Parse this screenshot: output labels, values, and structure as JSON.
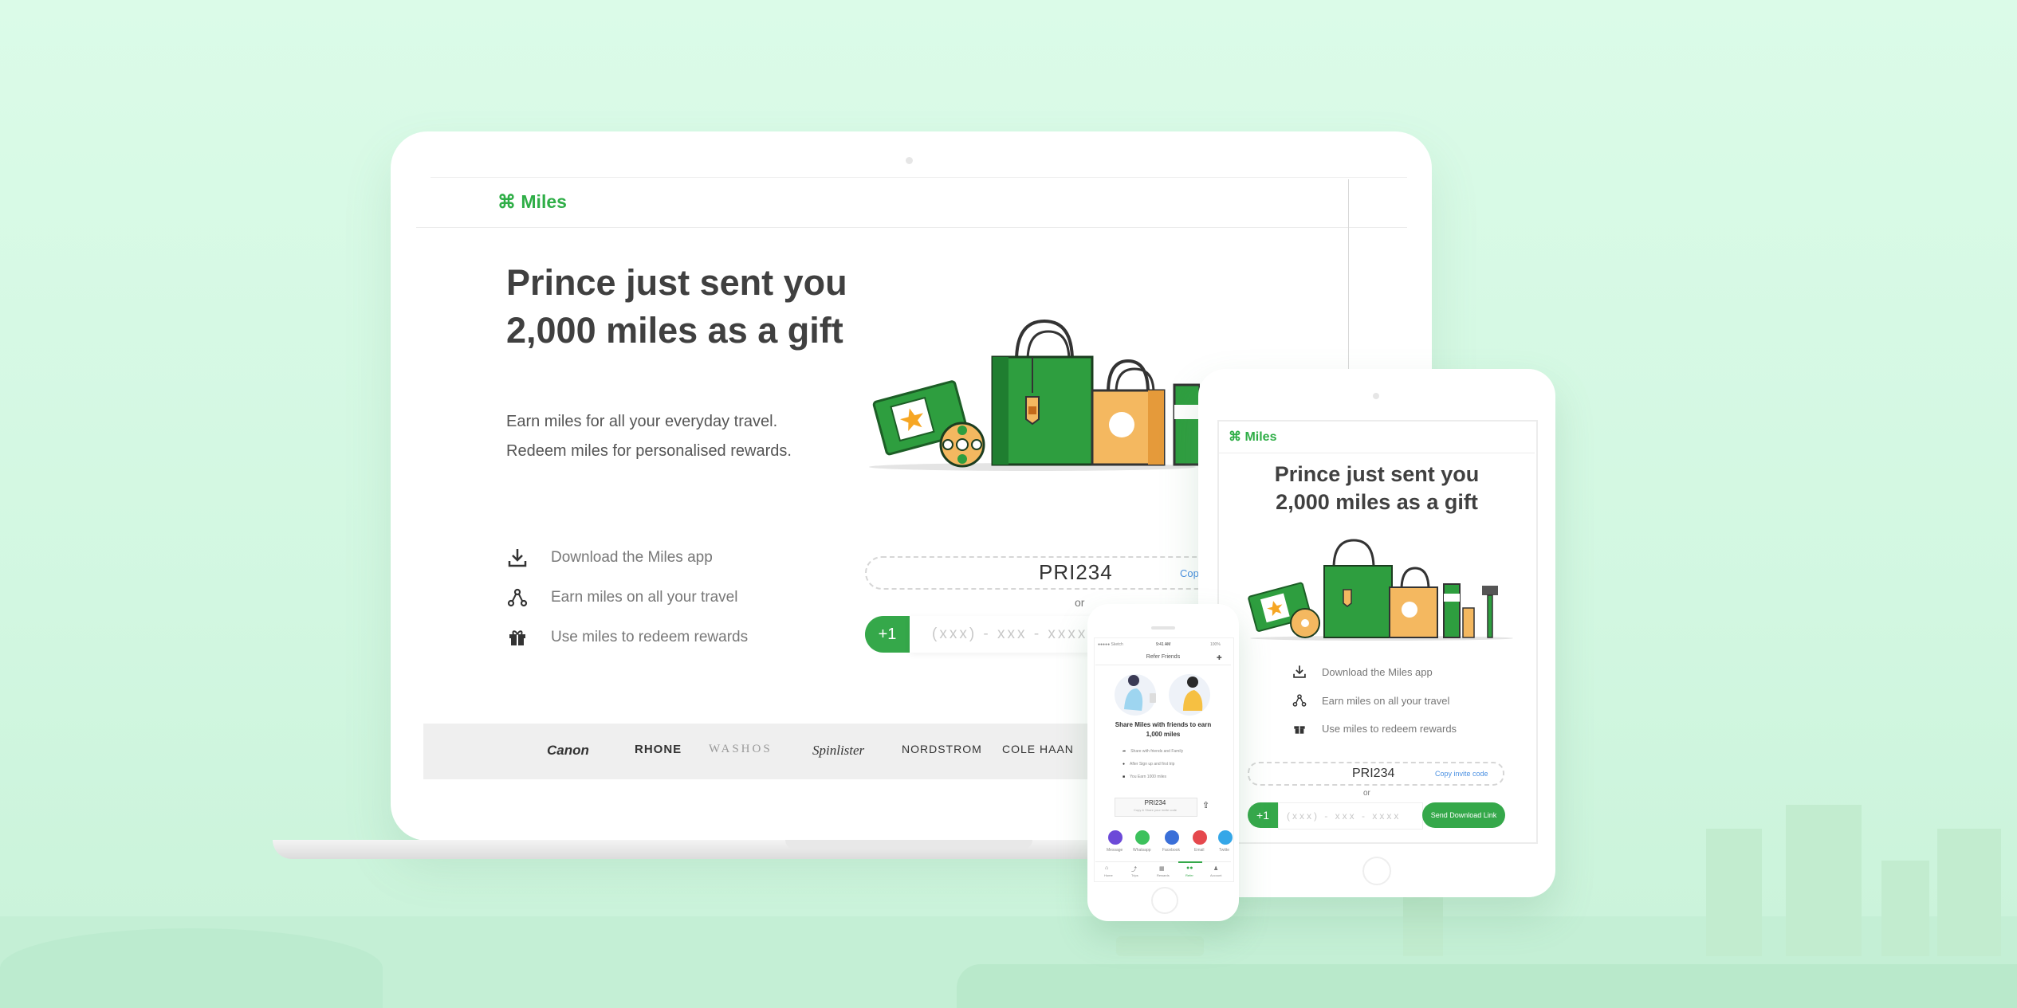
{
  "colors": {
    "brand": "#2fae47",
    "accent_blue": "#4a90e2",
    "background": "#d6f8e3"
  },
  "laptop": {
    "logo": "⌘ Miles",
    "headline_line1": "Prince just sent you",
    "headline_line2": "2,000 miles as a gift",
    "sub_line1": "Earn miles for all your everyday travel.",
    "sub_line2": "Redeem miles for personalised rewards.",
    "steps": [
      {
        "icon": "download-icon",
        "label": "Download the Miles app"
      },
      {
        "icon": "share-nodes-icon",
        "label": "Earn miles on all your  travel"
      },
      {
        "icon": "gift-icon",
        "label": "Use miles to redeem rewards"
      }
    ],
    "invite_code": "PRI234",
    "copy_label": "Cop",
    "or_label": "or",
    "country_code": "+1",
    "phone_placeholder": "(xxx) - xxx - xxxx",
    "brands": [
      "Canon",
      "RHONE",
      "WASHOS",
      "Spinlister",
      "NORDSTROM",
      "COLE HAAN"
    ]
  },
  "tablet": {
    "logo": "⌘ Miles",
    "headline_line1": "Prince just sent you",
    "headline_line2": "2,000 miles as a gift",
    "steps": [
      {
        "icon": "download-icon",
        "label": "Download the Miles app"
      },
      {
        "icon": "share-nodes-icon",
        "label": "Earn miles on all your  travel"
      },
      {
        "icon": "gift-icon",
        "label": "Use miles to redeem rewards"
      }
    ],
    "invite_code": "PRI234",
    "copy_label": "Copy invite code",
    "or_label": "or",
    "country_code": "+1",
    "phone_placeholder": "(xxx) - xxx - xxxx",
    "send_label": "Send Download Link"
  },
  "phone": {
    "carrier": "●●●●● Sketch",
    "time": "9:41 AM",
    "battery": "100%",
    "title": "Refer Friends",
    "share_line1": "Share Miles with friends to earn",
    "share_line2": "1,000 miles",
    "steps": [
      "Share with friends and Family",
      "After Sign up and first trip",
      "You Earn 1000 miles"
    ],
    "invite_code": "PRI234",
    "copy_hint": "Copy & Share your invite code",
    "share_apps": [
      {
        "label": "Message",
        "color": "#6c4ad8"
      },
      {
        "label": "Whatsapp",
        "color": "#3cc15c"
      },
      {
        "label": "Facebook",
        "color": "#3a6fd8"
      },
      {
        "label": "Email",
        "color": "#e5484d"
      },
      {
        "label": "Twitte",
        "color": "#35a7e8"
      }
    ],
    "tabs": [
      "Home",
      "Trips",
      "Rewards",
      "Refer",
      "Account"
    ]
  }
}
